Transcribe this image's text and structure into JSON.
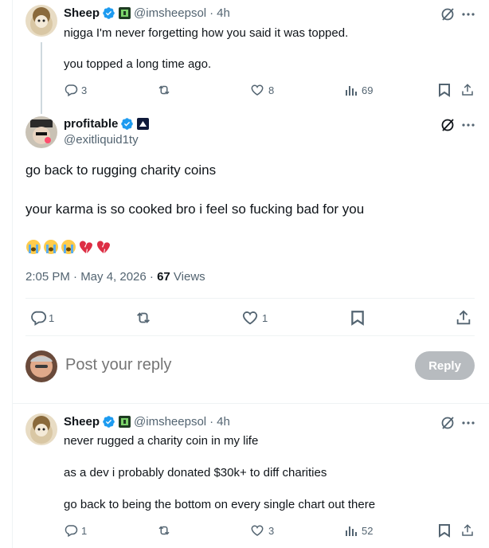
{
  "tweet1": {
    "name": "Sheep",
    "handle": "@imsheepsol",
    "time": "4h",
    "lines": [
      "nigga I'm never forgetting how you said it was topped.",
      "you topped a long time ago."
    ],
    "replies": "3",
    "likes": "8",
    "views": "69"
  },
  "main": {
    "name": "profitable",
    "handle": "@exitliquid1ty",
    "lines": [
      "go back to rugging charity coins",
      "your karma is so cooked bro i feel so fucking bad for you"
    ],
    "emojis": [
      "loudly-crying-face",
      "loudly-crying-face",
      "loudly-crying-face",
      "broken-heart",
      "broken-heart"
    ],
    "timestamp": "2:05 PM · May 4, 2026 · ",
    "views_count": "67",
    "views_label": " Views",
    "replies": "1",
    "likes": "1"
  },
  "composer": {
    "placeholder": "Post your reply",
    "button": "Reply"
  },
  "tweet2": {
    "name": "Sheep",
    "handle": "@imsheepsol",
    "time": "4h",
    "lines": [
      "never rugged a charity coin in my life",
      "as a dev i probably donated $30k+ to diff charities",
      "go back to being the bottom on every single chart out there"
    ],
    "replies": "1",
    "likes": "3",
    "views": "52"
  },
  "colors": {
    "verified": "#1d9bf0",
    "muted": "#536471",
    "button_disabled": "#b7bbbf"
  }
}
